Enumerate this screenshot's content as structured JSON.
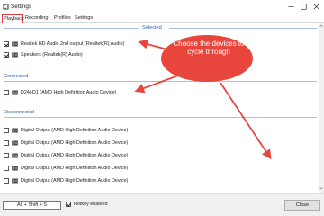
{
  "window": {
    "title": "Settings"
  },
  "tabs": [
    {
      "label": "Playback"
    },
    {
      "label": "Recording"
    },
    {
      "label": "Profiles"
    },
    {
      "label": "Settings"
    }
  ],
  "groups": {
    "selected": {
      "label": "Selected",
      "items": [
        {
          "label": "Realtek HD Audio 2nd output (Realtek(R) Audio)",
          "checked": true
        },
        {
          "label": "Speakers (Realtek(R) Audio)",
          "checked": true
        }
      ]
    },
    "connected": {
      "label": "Connected",
      "items": [
        {
          "label": "D24i-D1 (AMD High Definition Audio Device)",
          "checked": false
        }
      ]
    },
    "disconnected": {
      "label": "Disconnected",
      "items": [
        {
          "label": "Digital Output (AMD High Definition Audio Device)",
          "checked": false
        },
        {
          "label": "Digital Output (AMD High Definition Audio Device)",
          "checked": false
        },
        {
          "label": "Digital Output (AMD High Definition Audio Device)",
          "checked": false
        },
        {
          "label": "Digital Output (AMD High Definition Audio Device)",
          "checked": false
        },
        {
          "label": "Digital Output (AMD High Definition Audio Device)",
          "checked": false
        }
      ]
    }
  },
  "annotation": {
    "text": "Choose the devices to cycle through"
  },
  "footer": {
    "hotkey_value": "Alt + Shift + S",
    "hotkey_enabled_label": "Hotkey enabled",
    "hotkey_enabled": true,
    "close_label": "Close"
  },
  "colors": {
    "accent_red": "#e53935",
    "group_header": "#2e62a8",
    "callout_fill": "#e8463c"
  },
  "icons": {
    "app": "settings-app-icon",
    "device": "speaker-device-icon"
  }
}
